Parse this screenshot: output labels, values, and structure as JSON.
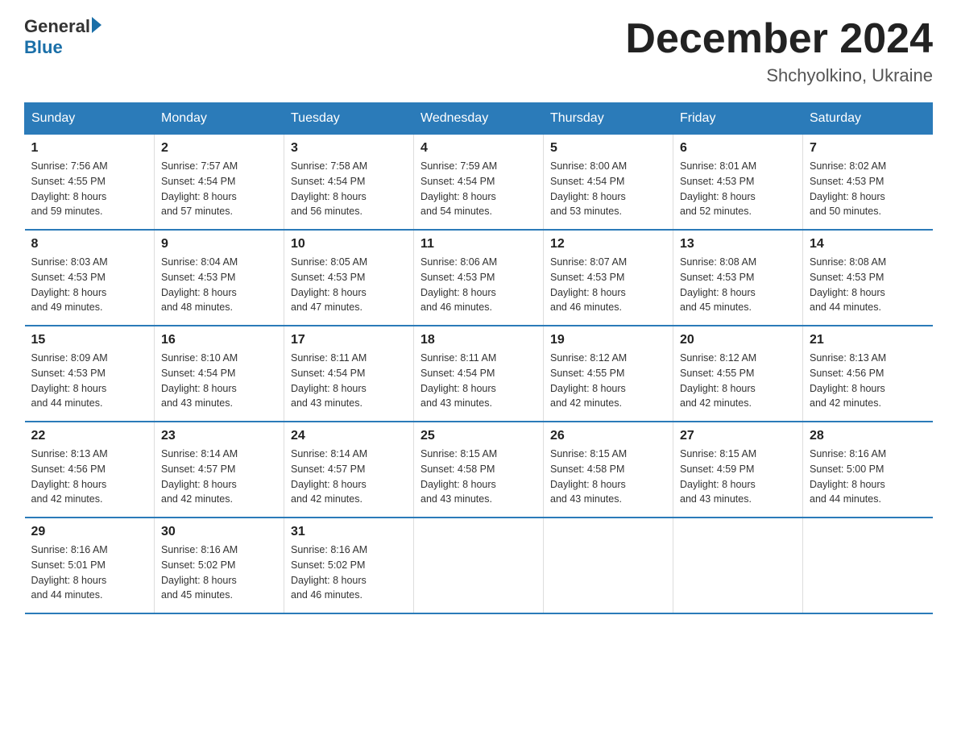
{
  "logo": {
    "text_general": "General",
    "text_blue": "Blue",
    "arrow": "▶"
  },
  "title": {
    "month_year": "December 2024",
    "location": "Shchyolkino, Ukraine"
  },
  "weekdays": [
    "Sunday",
    "Monday",
    "Tuesday",
    "Wednesday",
    "Thursday",
    "Friday",
    "Saturday"
  ],
  "weeks": [
    [
      {
        "day": "1",
        "sunrise": "7:56 AM",
        "sunset": "4:55 PM",
        "daylight": "8 hours and 59 minutes."
      },
      {
        "day": "2",
        "sunrise": "7:57 AM",
        "sunset": "4:54 PM",
        "daylight": "8 hours and 57 minutes."
      },
      {
        "day": "3",
        "sunrise": "7:58 AM",
        "sunset": "4:54 PM",
        "daylight": "8 hours and 56 minutes."
      },
      {
        "day": "4",
        "sunrise": "7:59 AM",
        "sunset": "4:54 PM",
        "daylight": "8 hours and 54 minutes."
      },
      {
        "day": "5",
        "sunrise": "8:00 AM",
        "sunset": "4:54 PM",
        "daylight": "8 hours and 53 minutes."
      },
      {
        "day": "6",
        "sunrise": "8:01 AM",
        "sunset": "4:53 PM",
        "daylight": "8 hours and 52 minutes."
      },
      {
        "day": "7",
        "sunrise": "8:02 AM",
        "sunset": "4:53 PM",
        "daylight": "8 hours and 50 minutes."
      }
    ],
    [
      {
        "day": "8",
        "sunrise": "8:03 AM",
        "sunset": "4:53 PM",
        "daylight": "8 hours and 49 minutes."
      },
      {
        "day": "9",
        "sunrise": "8:04 AM",
        "sunset": "4:53 PM",
        "daylight": "8 hours and 48 minutes."
      },
      {
        "day": "10",
        "sunrise": "8:05 AM",
        "sunset": "4:53 PM",
        "daylight": "8 hours and 47 minutes."
      },
      {
        "day": "11",
        "sunrise": "8:06 AM",
        "sunset": "4:53 PM",
        "daylight": "8 hours and 46 minutes."
      },
      {
        "day": "12",
        "sunrise": "8:07 AM",
        "sunset": "4:53 PM",
        "daylight": "8 hours and 46 minutes."
      },
      {
        "day": "13",
        "sunrise": "8:08 AM",
        "sunset": "4:53 PM",
        "daylight": "8 hours and 45 minutes."
      },
      {
        "day": "14",
        "sunrise": "8:08 AM",
        "sunset": "4:53 PM",
        "daylight": "8 hours and 44 minutes."
      }
    ],
    [
      {
        "day": "15",
        "sunrise": "8:09 AM",
        "sunset": "4:53 PM",
        "daylight": "8 hours and 44 minutes."
      },
      {
        "day": "16",
        "sunrise": "8:10 AM",
        "sunset": "4:54 PM",
        "daylight": "8 hours and 43 minutes."
      },
      {
        "day": "17",
        "sunrise": "8:11 AM",
        "sunset": "4:54 PM",
        "daylight": "8 hours and 43 minutes."
      },
      {
        "day": "18",
        "sunrise": "8:11 AM",
        "sunset": "4:54 PM",
        "daylight": "8 hours and 43 minutes."
      },
      {
        "day": "19",
        "sunrise": "8:12 AM",
        "sunset": "4:55 PM",
        "daylight": "8 hours and 42 minutes."
      },
      {
        "day": "20",
        "sunrise": "8:12 AM",
        "sunset": "4:55 PM",
        "daylight": "8 hours and 42 minutes."
      },
      {
        "day": "21",
        "sunrise": "8:13 AM",
        "sunset": "4:56 PM",
        "daylight": "8 hours and 42 minutes."
      }
    ],
    [
      {
        "day": "22",
        "sunrise": "8:13 AM",
        "sunset": "4:56 PM",
        "daylight": "8 hours and 42 minutes."
      },
      {
        "day": "23",
        "sunrise": "8:14 AM",
        "sunset": "4:57 PM",
        "daylight": "8 hours and 42 minutes."
      },
      {
        "day": "24",
        "sunrise": "8:14 AM",
        "sunset": "4:57 PM",
        "daylight": "8 hours and 42 minutes."
      },
      {
        "day": "25",
        "sunrise": "8:15 AM",
        "sunset": "4:58 PM",
        "daylight": "8 hours and 43 minutes."
      },
      {
        "day": "26",
        "sunrise": "8:15 AM",
        "sunset": "4:58 PM",
        "daylight": "8 hours and 43 minutes."
      },
      {
        "day": "27",
        "sunrise": "8:15 AM",
        "sunset": "4:59 PM",
        "daylight": "8 hours and 43 minutes."
      },
      {
        "day": "28",
        "sunrise": "8:16 AM",
        "sunset": "5:00 PM",
        "daylight": "8 hours and 44 minutes."
      }
    ],
    [
      {
        "day": "29",
        "sunrise": "8:16 AM",
        "sunset": "5:01 PM",
        "daylight": "8 hours and 44 minutes."
      },
      {
        "day": "30",
        "sunrise": "8:16 AM",
        "sunset": "5:02 PM",
        "daylight": "8 hours and 45 minutes."
      },
      {
        "day": "31",
        "sunrise": "8:16 AM",
        "sunset": "5:02 PM",
        "daylight": "8 hours and 46 minutes."
      },
      null,
      null,
      null,
      null
    ]
  ],
  "labels": {
    "sunrise": "Sunrise:",
    "sunset": "Sunset:",
    "daylight": "Daylight:"
  }
}
